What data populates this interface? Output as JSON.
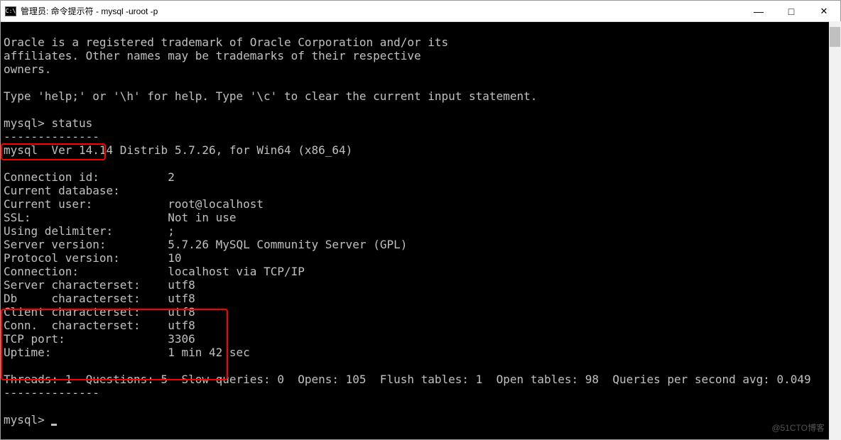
{
  "window": {
    "title": "管理员: 命令提示符 - mysql  -uroot -p",
    "icon_label": "C:\\"
  },
  "intro": {
    "line1": "Oracle is a registered trademark of Oracle Corporation and/or its",
    "line2": "affiliates. Other names may be trademarks of their respective",
    "line3": "owners.",
    "help": "Type 'help;' or '\\h' for help. Type '\\c' to clear the current input statement."
  },
  "prompt1": {
    "prompt": "mysql>",
    "command": "status"
  },
  "separator1": "--------------",
  "version": "mysql  Ver 14.14 Distrib 5.7.26, for Win64 (x86_64)",
  "status": {
    "connection_id": {
      "label": "Connection id:",
      "value": "2"
    },
    "current_database": {
      "label": "Current database:",
      "value": ""
    },
    "current_user": {
      "label": "Current user:",
      "value": "root@localhost"
    },
    "ssl": {
      "label": "SSL:",
      "value": "Not in use"
    },
    "using_delimiter": {
      "label": "Using delimiter:",
      "value": ";"
    },
    "server_version": {
      "label": "Server version:",
      "value": "5.7.26 MySQL Community Server (GPL)"
    },
    "protocol_version": {
      "label": "Protocol version:",
      "value": "10"
    },
    "connection": {
      "label": "Connection:",
      "value": "localhost via TCP/IP"
    },
    "server_charset": {
      "label": "Server characterset:",
      "value": "utf8"
    },
    "db_charset": {
      "label": "Db     characterset:",
      "value": "utf8"
    },
    "client_charset": {
      "label": "Client characterset:",
      "value": "utf8"
    },
    "conn_charset": {
      "label": "Conn.  characterset:",
      "value": "utf8"
    },
    "tcp_port": {
      "label": "TCP port:",
      "value": "3306"
    },
    "uptime": {
      "label": "Uptime:",
      "value": "1 min 42 sec"
    }
  },
  "summary": "Threads: 1  Questions: 5  Slow queries: 0  Opens: 105  Flush tables: 1  Open tables: 98  Queries per second avg: 0.049",
  "separator2": "--------------",
  "prompt2": {
    "prompt": "mysql>"
  },
  "watermark": "@51CTO博客"
}
